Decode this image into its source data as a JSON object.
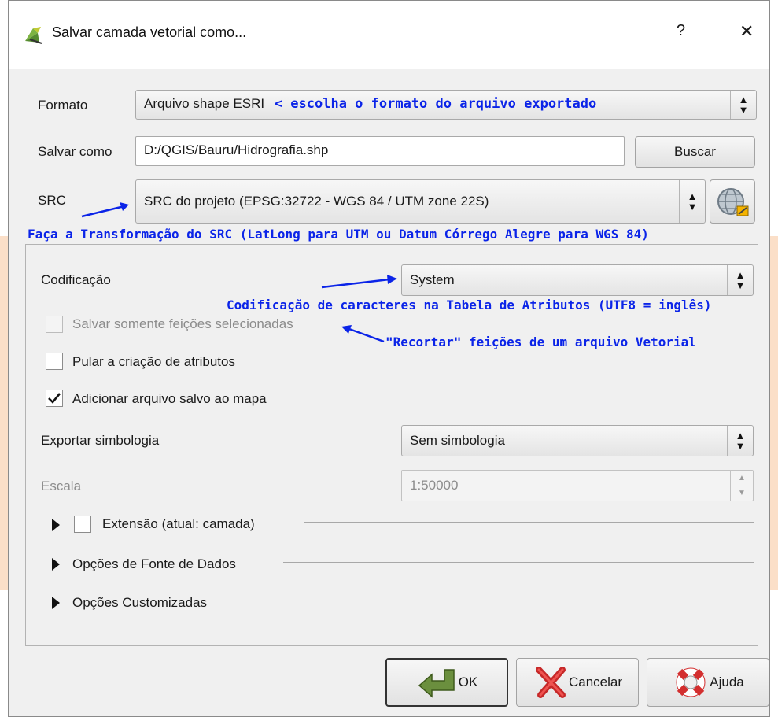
{
  "window": {
    "title": "Salvar camada vetorial como...",
    "help_glyph": "?",
    "close_glyph": "✕"
  },
  "form": {
    "formato_label": "Formato",
    "formato_value": "Arquivo shape ESRI",
    "salvar_label": "Salvar como",
    "salvar_value": "D:/QGIS/Bauru/Hidrografia.shp",
    "buscar_label": "Buscar",
    "src_label": "SRC",
    "src_value": "SRC do projeto (EPSG:32722 - WGS 84 / UTM zone 22S)"
  },
  "options": {
    "codificacao_label": "Codificação",
    "codificacao_value": "System",
    "salvar_selecionadas_label": "Salvar somente feições selecionadas",
    "pular_atributos_label": "Pular a criação de atributos",
    "adicionar_mapa_label": "Adicionar arquivo salvo ao mapa",
    "adicionar_mapa_checked": true,
    "exportar_label": "Exportar simbologia",
    "exportar_value": "Sem simbologia",
    "escala_label": "Escala",
    "escala_value": "1:50000",
    "extensao_label": "Extensão (atual: camada)",
    "fonte_label": "Opções de Fonte de Dados",
    "custom_label": "Opções Customizadas"
  },
  "annotations": {
    "formato_note": "< escolha o formato do arquivo exportado",
    "src_note": "Faça a Transformação do SRC (LatLong para UTM ou Datum Córrego Alegre para WGS 84)",
    "codificacao_note": "Codificação de caracteres na Tabela de Atributos (UTF8 = inglês)",
    "recortar_note": "\"Recortar\" feições de um arquivo Vetorial"
  },
  "buttons": {
    "ok": "OK",
    "cancelar": "Cancelar",
    "ajuda": "Ajuda"
  },
  "icons": {
    "app": "qgis-icon",
    "crs": "globe-crs-icon",
    "ok": "ok-arrow-icon",
    "cancel": "cancel-x-icon",
    "help": "lifebuoy-icon"
  },
  "colors": {
    "annotation": "#0b24e8",
    "dialog_bg": "#f0f0f0"
  }
}
